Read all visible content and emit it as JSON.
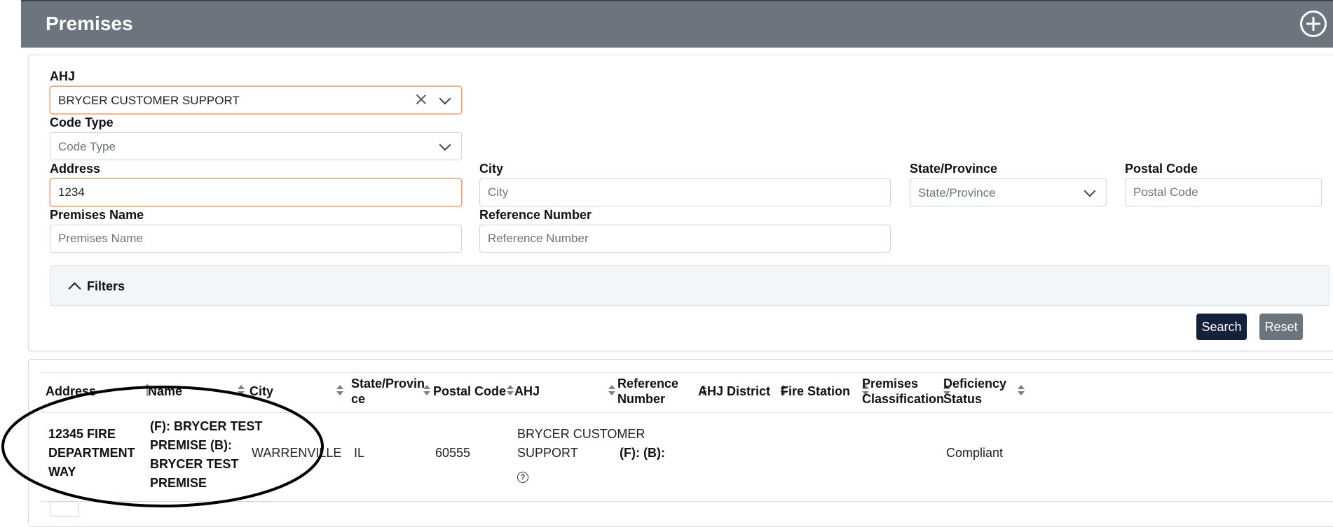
{
  "header": {
    "title": "Premises",
    "add_icon": "plus-circle-icon"
  },
  "form": {
    "ahj": {
      "label": "AHJ",
      "value": "BRYCER CUSTOMER SUPPORT"
    },
    "code_type": {
      "label": "Code Type",
      "placeholder": "Code Type"
    },
    "address": {
      "label": "Address",
      "value": "1234"
    },
    "city": {
      "label": "City",
      "placeholder": "City"
    },
    "state": {
      "label": "State/Province",
      "placeholder": "State/Province"
    },
    "postal": {
      "label": "Postal Code",
      "placeholder": "Postal Code"
    },
    "premises_name": {
      "label": "Premises Name",
      "placeholder": "Premises Name"
    },
    "reference": {
      "label": "Reference Number",
      "placeholder": "Reference Number"
    },
    "filters_label": "Filters",
    "search_label": "Search",
    "reset_label": "Reset"
  },
  "table": {
    "columns": [
      {
        "line1": "Address",
        "line2": ""
      },
      {
        "line1": "Name",
        "line2": ""
      },
      {
        "line1": "City",
        "line2": ""
      },
      {
        "line1": "State/Provin",
        "line2": "ce"
      },
      {
        "line1": "Postal Code",
        "line2": ""
      },
      {
        "line1": "AHJ",
        "line2": ""
      },
      {
        "line1": "Reference",
        "line2": "Number"
      },
      {
        "line1": "AHJ District",
        "line2": ""
      },
      {
        "line1": "Fire Station",
        "line2": ""
      },
      {
        "line1": "Premises",
        "line2": "Classification"
      },
      {
        "line1": "Deficiency",
        "line2": "Status"
      }
    ],
    "row": {
      "address": [
        "12345 FIRE",
        "DEPARTMENT",
        "WAY"
      ],
      "name": [
        "(F): BRYCER TEST",
        "PREMISE (B):",
        "BRYCER TEST",
        "PREMISE"
      ],
      "city": "WARRENVILLE",
      "state": "IL",
      "postal": "60555",
      "ahj": [
        "BRYCER CUSTOMER",
        "SUPPORT"
      ],
      "ahj_help_icon": "question-circle-icon",
      "reference": "(F): (B):",
      "ahj_district": "",
      "fire_station": "",
      "classification": "",
      "status": "Compliant"
    }
  },
  "colors": {
    "header_bg": "#6c757d",
    "search_btn": "#14213d",
    "reset_btn": "#6c757d",
    "active_border": "#f0a276",
    "filters_bg": "#f1f6fb"
  }
}
